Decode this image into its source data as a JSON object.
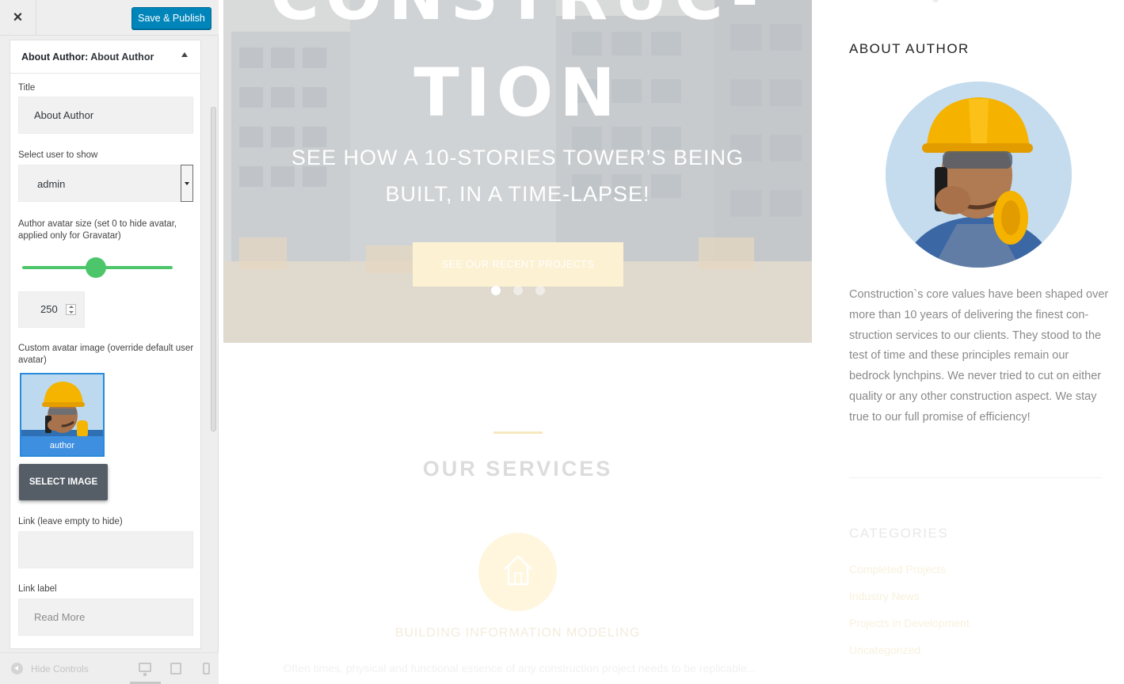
{
  "customizer": {
    "close_label": "×",
    "publish_label": "Save & Publish",
    "section": {
      "title_prefix": "About Author:",
      "title_name": "About Author"
    },
    "fields": {
      "title_label": "Title",
      "title_value": "About Author",
      "user_label": "Select user to show",
      "user_value": "admin",
      "avatar_size_label": "Author avatar size (set 0 to hide avatar, applied only for Gravatar)",
      "avatar_size_fraction": 0.49,
      "avatar_size_value": "250",
      "custom_avatar_label": "Custom avatar image (override default user avatar)",
      "avatar_caption": "author",
      "select_image_label": "SELECT IMAGE",
      "link_label": "Link (leave empty to hide)",
      "link_value": "",
      "link_label_label": "Link label",
      "link_label_placeholder": "Read More"
    },
    "footer": {
      "hide_controls_label": "Hide Controls",
      "devices": [
        "desktop-icon",
        "tablet-icon",
        "mobile-icon"
      ]
    }
  },
  "preview": {
    "hero": {
      "heading_line1": "CONSTRUC-",
      "heading_line2": "TION",
      "subtitle_line1": "SEE HOW A 10-STORIES TOWER’S BEING",
      "subtitle_line2": "BUILT, IN A TIME-LAPSE!",
      "cta_label": "SEE OUR RECENT PROJECTS",
      "slide_count": 3,
      "active_slide": 1
    },
    "services": {
      "title": "OUR SERVICES",
      "icon": "house-icon",
      "item_title": "BUILDING INFORMATION MODELING",
      "item_desc": "Often times, physical and functional essence of any construction project needs to be replicable..."
    },
    "about_widget": {
      "title": "ABOUT AUTHOR",
      "bio": "Construction`s core values have been shaped over more than 10 years of delivering the finest con-struction services to our clients. They stood to the test of time and these principles remain our bedrock lynchpins. We never tried to cut on either quality or any other construction aspect. We stay true to our full promise of efficiency!"
    },
    "categories_widget": {
      "title": "CATEGORIES",
      "items": [
        "Completed Projects",
        "Industry News",
        "Projects in Development",
        "Uncategorized"
      ]
    }
  },
  "colors": {
    "publish_blue": "#0085ba",
    "slider_green": "#4dc66b",
    "accent_gold": "#f5c343"
  }
}
